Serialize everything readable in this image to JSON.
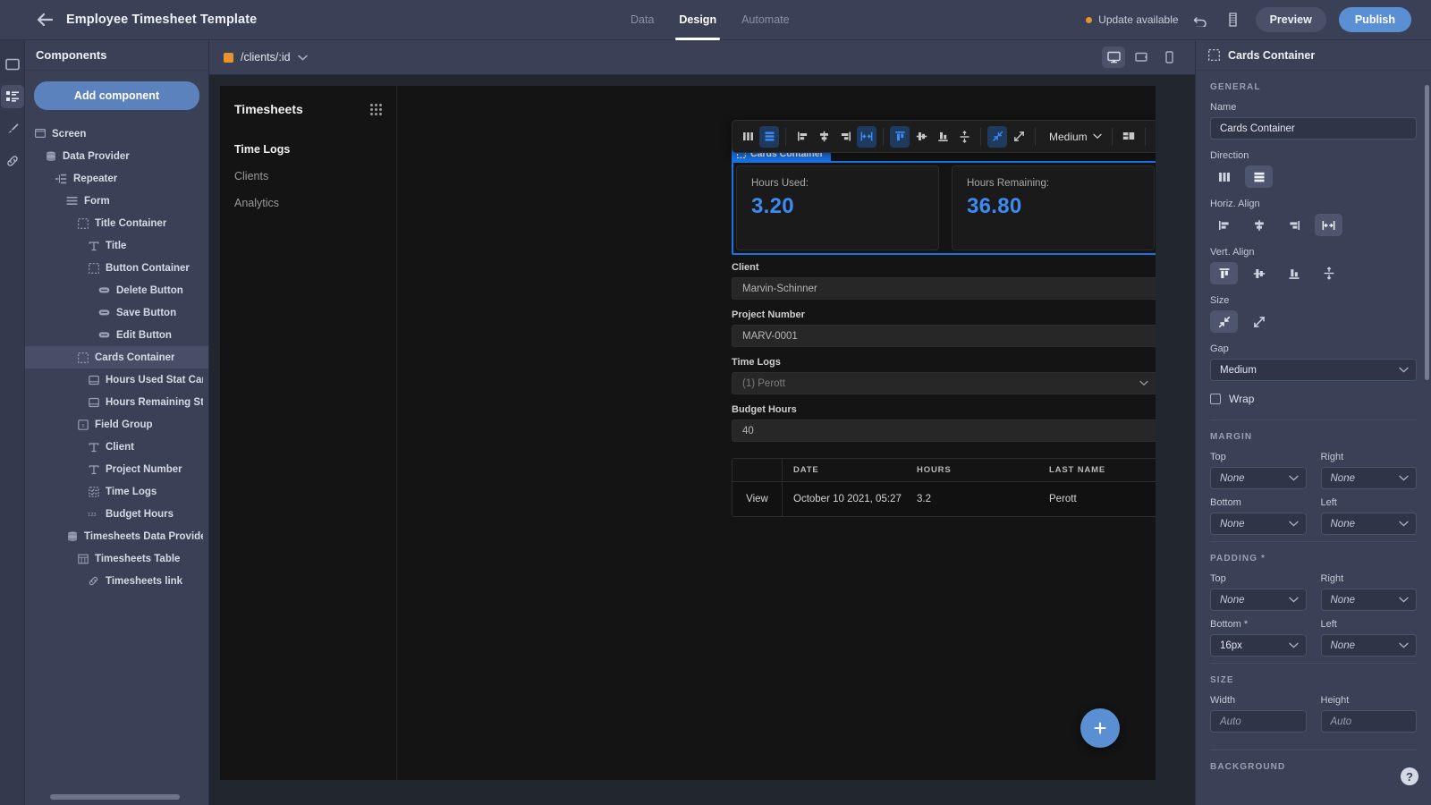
{
  "topbar": {
    "back_icon": "back-arrow-icon",
    "app_title": "Employee Timesheet Template",
    "tabs": [
      {
        "label": "Data",
        "active": false
      },
      {
        "label": "Design",
        "active": true
      },
      {
        "label": "Automate",
        "active": false
      }
    ],
    "update_text": "Update available",
    "undo_icon": "undo-icon",
    "history_icon": "history-icon",
    "preview_label": "Preview",
    "publish_label": "Publish",
    "accent_blue": "#5b8fd4",
    "accent_orange": "#e8922c"
  },
  "rail": {
    "items": [
      {
        "name": "screen-icon",
        "active": false
      },
      {
        "name": "components-icon",
        "active": true
      },
      {
        "name": "theme-brush-icon",
        "active": false
      },
      {
        "name": "links-icon",
        "active": false
      }
    ]
  },
  "components_panel": {
    "title": "Components",
    "add_button": "Add component",
    "tree": [
      {
        "label": "Screen",
        "depth": 0,
        "icon": "screen-icon",
        "selected": false
      },
      {
        "label": "Data Provider",
        "depth": 1,
        "icon": "database-icon",
        "selected": false
      },
      {
        "label": "Repeater",
        "depth": 2,
        "icon": "repeater-icon",
        "selected": false
      },
      {
        "label": "Form",
        "depth": 3,
        "icon": "form-icon",
        "selected": false
      },
      {
        "label": "Title Container",
        "depth": 4,
        "icon": "container-icon",
        "selected": false
      },
      {
        "label": "Title",
        "depth": 5,
        "icon": "text-icon",
        "selected": false
      },
      {
        "label": "Button Container",
        "depth": 5,
        "icon": "container-icon",
        "selected": false
      },
      {
        "label": "Delete Button",
        "depth": 6,
        "icon": "button-icon",
        "selected": false
      },
      {
        "label": "Save Button",
        "depth": 6,
        "icon": "button-icon",
        "selected": false
      },
      {
        "label": "Edit Button",
        "depth": 6,
        "icon": "button-icon",
        "selected": false
      },
      {
        "label": "Cards Container",
        "depth": 4,
        "icon": "container-icon",
        "selected": true
      },
      {
        "label": "Hours Used Stat Card",
        "depth": 5,
        "icon": "card-icon",
        "selected": false
      },
      {
        "label": "Hours Remaining Stat Card",
        "depth": 5,
        "icon": "card-icon",
        "selected": false
      },
      {
        "label": "Field Group",
        "depth": 4,
        "icon": "field-group-icon",
        "selected": false
      },
      {
        "label": "Client",
        "depth": 5,
        "icon": "text-icon",
        "selected": false
      },
      {
        "label": "Project Number",
        "depth": 5,
        "icon": "text-icon",
        "selected": false
      },
      {
        "label": "Time Logs",
        "depth": 5,
        "icon": "select-icon",
        "selected": false
      },
      {
        "label": "Budget Hours",
        "depth": 5,
        "icon": "number-icon",
        "selected": false
      },
      {
        "label": "Timesheets Data Provider",
        "depth": 3,
        "icon": "database-icon",
        "selected": false
      },
      {
        "label": "Timesheets Table",
        "depth": 4,
        "icon": "table-icon",
        "selected": false
      },
      {
        "label": "Timesheets link",
        "depth": 5,
        "icon": "link-icon",
        "selected": false
      }
    ]
  },
  "canvas_top": {
    "route": "/clients/:id",
    "route_chevron_icon": "chevron-down-icon",
    "devices": [
      {
        "name": "desktop-icon",
        "active": true
      },
      {
        "name": "tablet-icon",
        "active": false
      },
      {
        "name": "mobile-icon",
        "active": false
      }
    ]
  },
  "toolbar": {
    "gap_value": "Medium",
    "buttons": [
      {
        "name": "direction-column-icon",
        "on": false
      },
      {
        "name": "direction-row-icon",
        "on": true
      },
      {
        "name": "align-left-icon",
        "on": false
      },
      {
        "name": "align-center-icon",
        "on": false
      },
      {
        "name": "align-right-icon",
        "on": false
      },
      {
        "name": "align-space-between-icon",
        "on": true
      },
      {
        "name": "align-top-icon",
        "on": true
      },
      {
        "name": "align-middle-icon",
        "on": false
      },
      {
        "name": "align-bottom-icon",
        "on": false
      },
      {
        "name": "align-stretch-icon",
        "on": false
      },
      {
        "name": "size-shrink-icon",
        "on": true
      },
      {
        "name": "size-grow-icon",
        "on": false
      },
      {
        "name": "layout-icon",
        "on": false
      },
      {
        "name": "duplicate-icon",
        "on": false
      },
      {
        "name": "delete-icon",
        "on": false
      }
    ]
  },
  "preview_page": {
    "nav_title": "Timesheets",
    "grip_icon": "drag-grip-icon",
    "nav_items": [
      {
        "label": "Time Logs",
        "active": true
      },
      {
        "label": "Clients",
        "active": false
      },
      {
        "label": "Analytics",
        "active": false
      }
    ],
    "selection_badge": "Cards Container",
    "selection_badge_icon": "container-icon",
    "cards": [
      {
        "label": "Hours Used:",
        "value": "3.20"
      },
      {
        "label": "Hours Remaining:",
        "value": "36.80"
      }
    ],
    "fields": [
      {
        "label": "Client",
        "value": "Marvin-Schinner",
        "type": "text"
      },
      {
        "label": "Project Number",
        "value": "MARV-0001",
        "type": "text"
      },
      {
        "label": "Time Logs",
        "value": "(1) Perott",
        "type": "select"
      },
      {
        "label": "Budget Hours",
        "value": "40",
        "type": "text"
      }
    ],
    "table": {
      "columns": [
        "",
        "DATE",
        "HOURS",
        "LAST NAME"
      ],
      "rows": [
        {
          "action": "View",
          "date": "October 10 2021, 05:27",
          "hours": "3.2",
          "last_name": "Perott"
        }
      ]
    },
    "fab_icon": "plus-icon",
    "stat_value_color": "#3d8bf2"
  },
  "props": {
    "header_title": "Cards Container",
    "header_icon": "container-icon",
    "general": {
      "section": "GENERAL",
      "name_label": "Name",
      "name_value": "Cards Container",
      "direction_label": "Direction",
      "direction_options": [
        {
          "name": "direction-column-icon",
          "on": false
        },
        {
          "name": "direction-row-icon",
          "on": true
        }
      ],
      "horiz_label": "Horiz. Align",
      "horiz_options": [
        {
          "name": "align-left-icon",
          "on": false
        },
        {
          "name": "align-center-icon",
          "on": false
        },
        {
          "name": "align-right-icon",
          "on": false
        },
        {
          "name": "align-space-between-icon",
          "on": true
        }
      ],
      "vert_label": "Vert. Align",
      "vert_options": [
        {
          "name": "align-top-icon",
          "on": true
        },
        {
          "name": "align-middle-icon",
          "on": false
        },
        {
          "name": "align-bottom-icon",
          "on": false
        },
        {
          "name": "align-stretch-icon",
          "on": false
        }
      ],
      "size_label": "Size",
      "size_options": [
        {
          "name": "size-shrink-icon",
          "on": true
        },
        {
          "name": "size-grow-icon",
          "on": false
        }
      ],
      "gap_label": "Gap",
      "gap_value": "Medium",
      "wrap_label": "Wrap",
      "wrap_checked": false
    },
    "margin": {
      "section": "MARGIN",
      "fields": [
        {
          "label": "Top",
          "value": "None"
        },
        {
          "label": "Right",
          "value": "None"
        },
        {
          "label": "Bottom",
          "value": "None"
        },
        {
          "label": "Left",
          "value": "None"
        }
      ]
    },
    "padding": {
      "section": "PADDING *",
      "fields": [
        {
          "label": "Top",
          "value": "None"
        },
        {
          "label": "Right",
          "value": "None"
        },
        {
          "label": "Bottom *",
          "value": "16px"
        },
        {
          "label": "Left",
          "value": "None"
        }
      ]
    },
    "size": {
      "section": "SIZE",
      "fields": [
        {
          "label": "Width",
          "value": "Auto"
        },
        {
          "label": "Height",
          "value": "Auto"
        }
      ]
    },
    "background": {
      "section": "BACKGROUND"
    },
    "help_icon": "help-icon",
    "help_label": "?"
  }
}
